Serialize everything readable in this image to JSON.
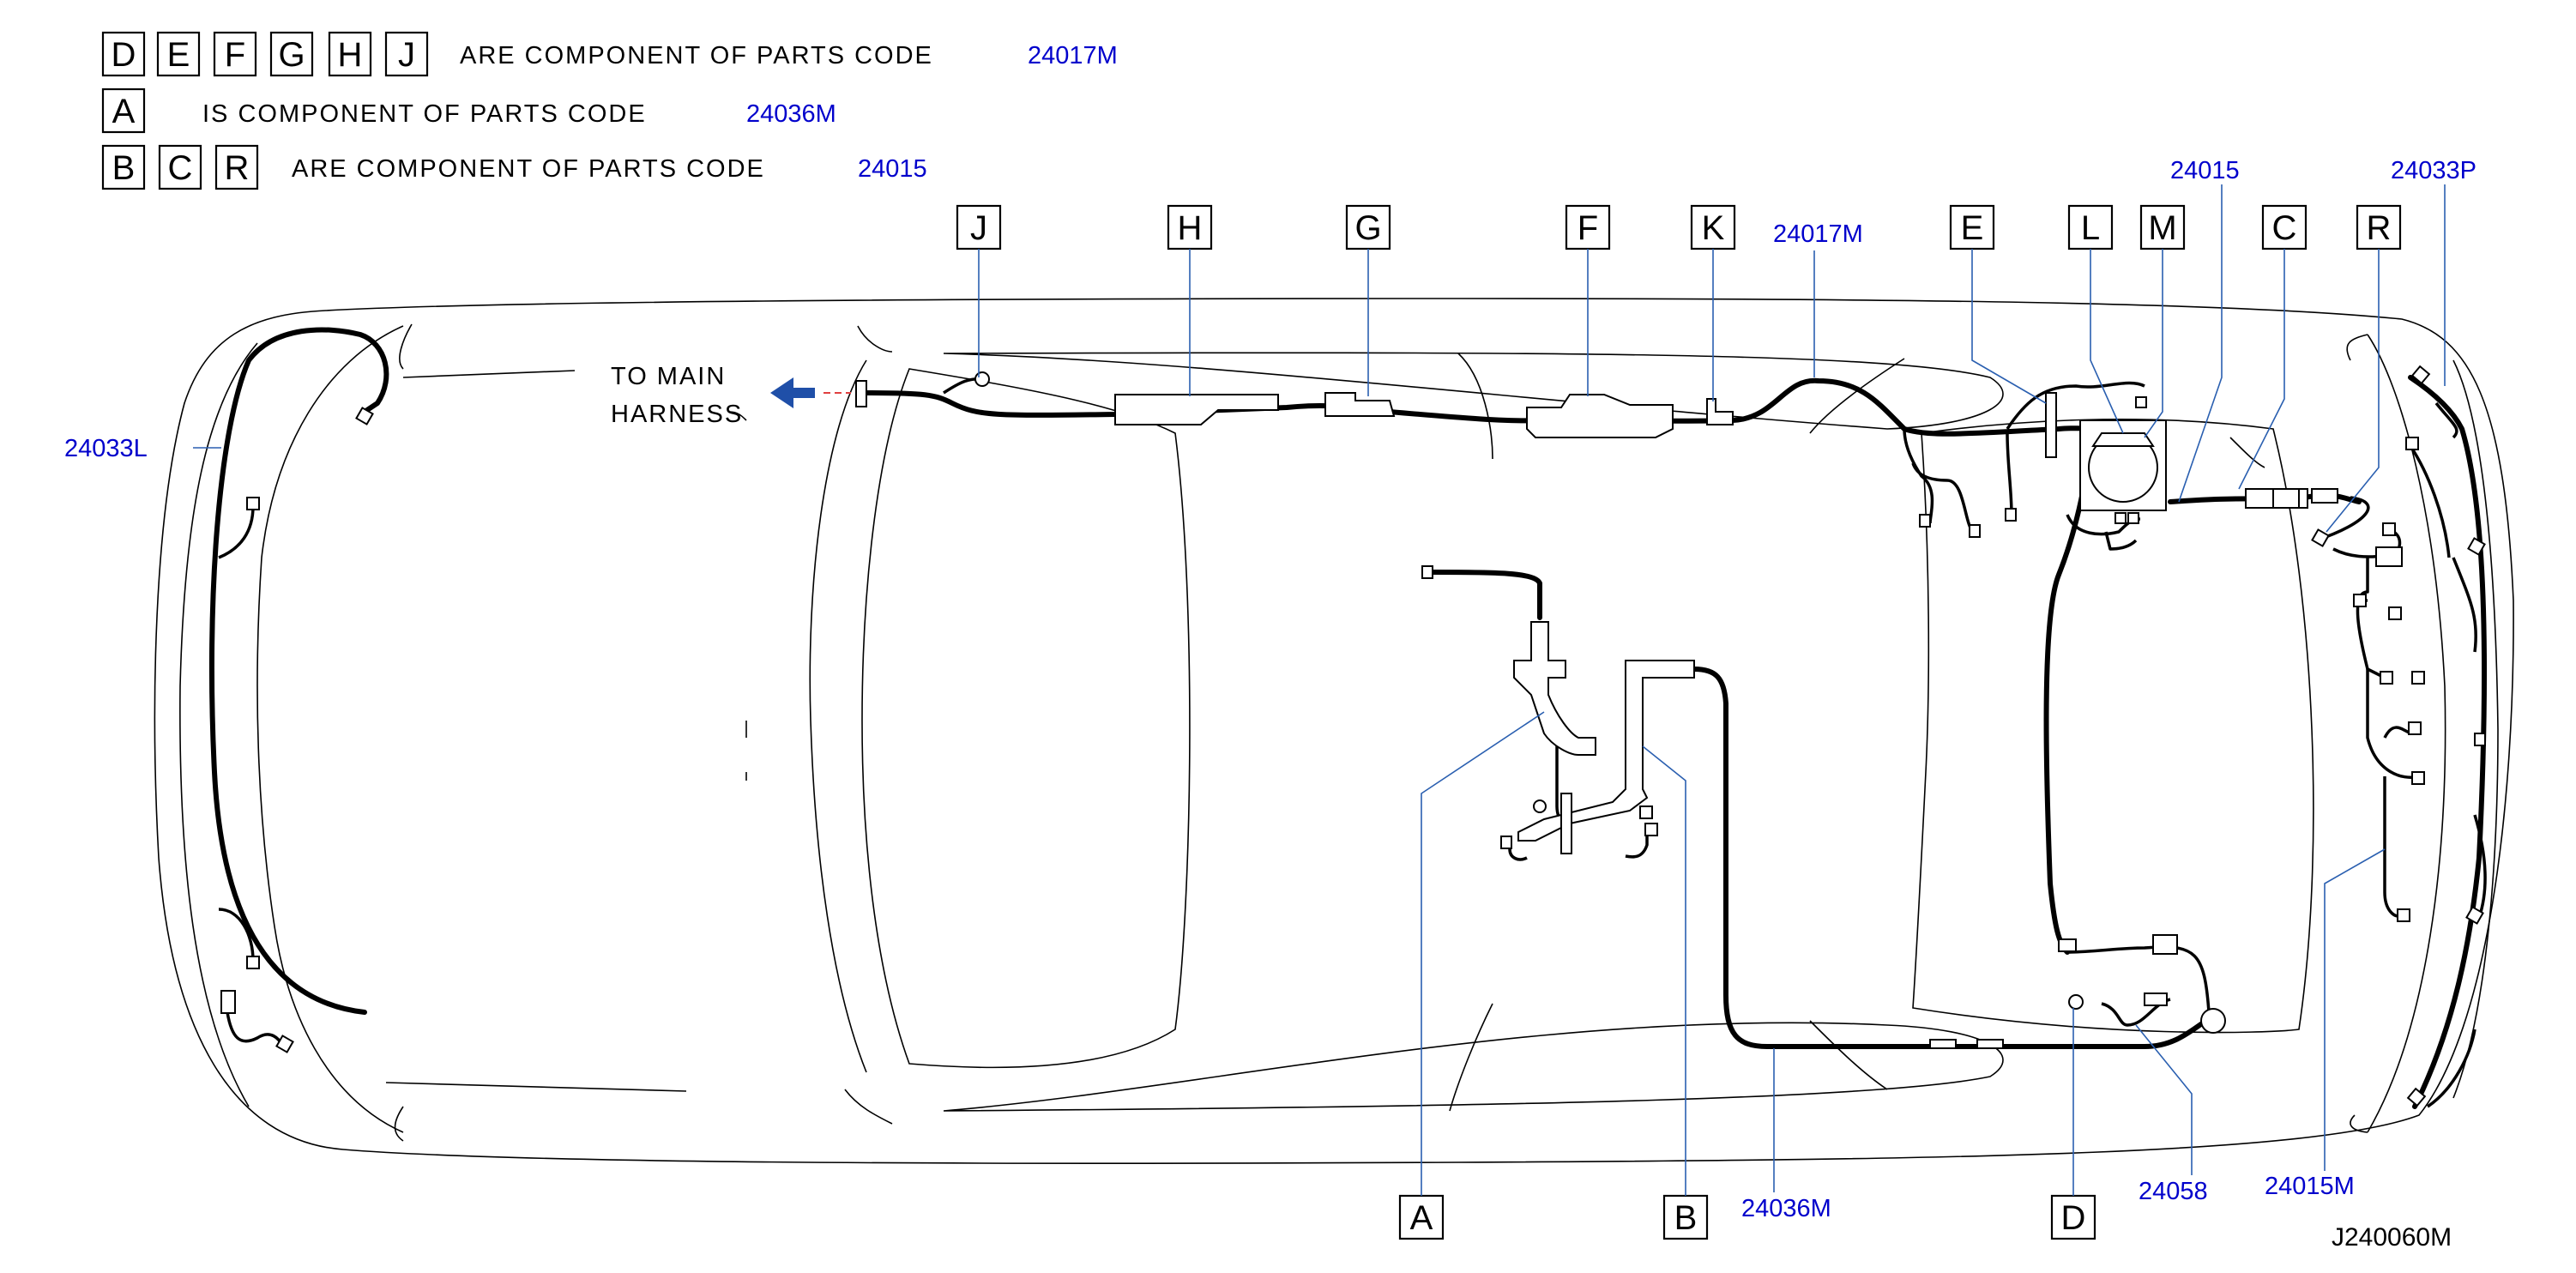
{
  "legend": [
    {
      "letters": [
        "D",
        "E",
        "F",
        "G",
        "H",
        "J"
      ],
      "text": "ARE  COMPONENT  OF  PARTS  CODE",
      "code": "24017M"
    },
    {
      "letters": [
        "A"
      ],
      "text": "IS  COMPONENT  OF  PARTS  CODE",
      "code": "24036M"
    },
    {
      "letters": [
        "B",
        "C",
        "R"
      ],
      "text": "ARE  COMPONENT  OF  PARTS  CODE",
      "code": "24015"
    }
  ],
  "main_harness": {
    "line1": "TO  MAIN",
    "line2": "HARNESS"
  },
  "top_callouts": [
    "J",
    "H",
    "G",
    "F",
    "K",
    "E",
    "L",
    "M",
    "C",
    "R"
  ],
  "bottom_callouts": [
    "A",
    "B",
    "D"
  ],
  "part_codes": {
    "top_24017m": "24017M",
    "top_24015": "24015",
    "top_24033p": "24033P",
    "left_24033l": "24033L",
    "bottom_24036m": "24036M",
    "bottom_24058": "24058",
    "bottom_24015m": "24015M"
  },
  "drawing_ref": "J240060M",
  "colors": {
    "code_text": "#0000cc",
    "leader_line": "#2a5fb0",
    "arrow": "#1f4fa8",
    "arrow_dash": "#e04040"
  },
  "icons": {
    "arrow": "left-arrow-icon"
  }
}
